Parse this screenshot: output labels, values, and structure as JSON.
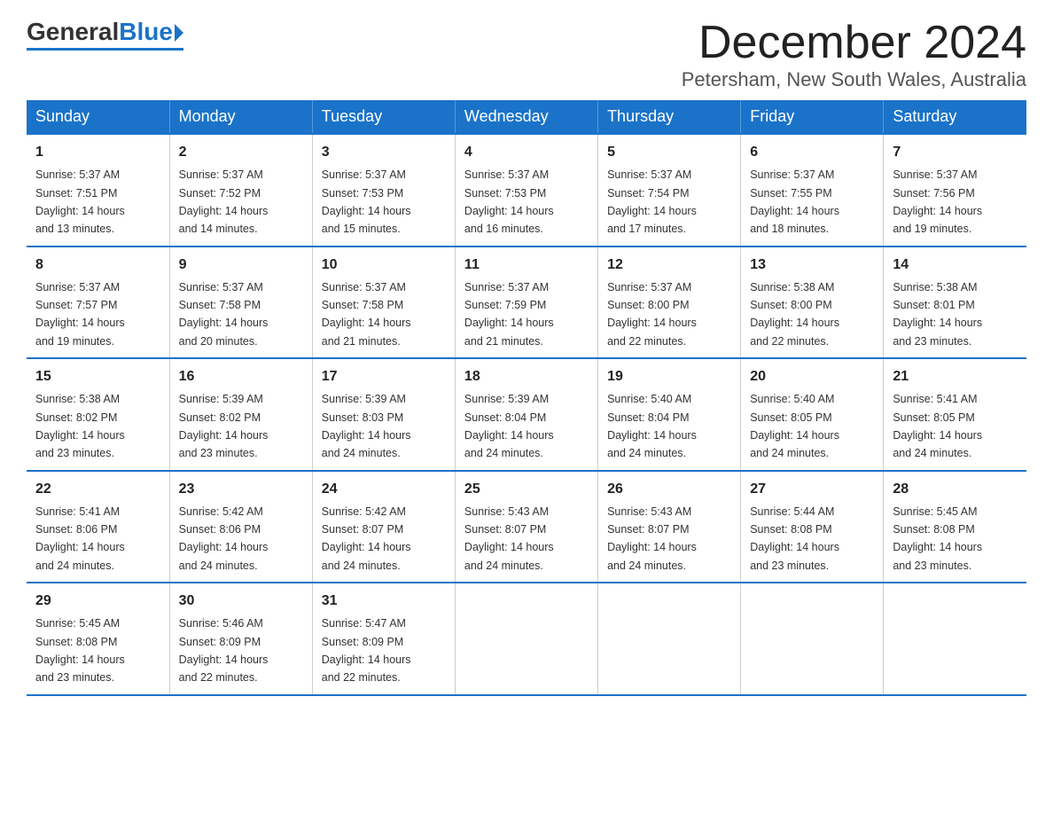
{
  "logo": {
    "general": "General",
    "blue": "Blue"
  },
  "title": "December 2024",
  "location": "Petersham, New South Wales, Australia",
  "weekdays": [
    "Sunday",
    "Monday",
    "Tuesday",
    "Wednesday",
    "Thursday",
    "Friday",
    "Saturday"
  ],
  "weeks": [
    [
      {
        "day": "1",
        "sunrise": "5:37 AM",
        "sunset": "7:51 PM",
        "daylight": "14 hours and 13 minutes."
      },
      {
        "day": "2",
        "sunrise": "5:37 AM",
        "sunset": "7:52 PM",
        "daylight": "14 hours and 14 minutes."
      },
      {
        "day": "3",
        "sunrise": "5:37 AM",
        "sunset": "7:53 PM",
        "daylight": "14 hours and 15 minutes."
      },
      {
        "day": "4",
        "sunrise": "5:37 AM",
        "sunset": "7:53 PM",
        "daylight": "14 hours and 16 minutes."
      },
      {
        "day": "5",
        "sunrise": "5:37 AM",
        "sunset": "7:54 PM",
        "daylight": "14 hours and 17 minutes."
      },
      {
        "day": "6",
        "sunrise": "5:37 AM",
        "sunset": "7:55 PM",
        "daylight": "14 hours and 18 minutes."
      },
      {
        "day": "7",
        "sunrise": "5:37 AM",
        "sunset": "7:56 PM",
        "daylight": "14 hours and 19 minutes."
      }
    ],
    [
      {
        "day": "8",
        "sunrise": "5:37 AM",
        "sunset": "7:57 PM",
        "daylight": "14 hours and 19 minutes."
      },
      {
        "day": "9",
        "sunrise": "5:37 AM",
        "sunset": "7:58 PM",
        "daylight": "14 hours and 20 minutes."
      },
      {
        "day": "10",
        "sunrise": "5:37 AM",
        "sunset": "7:58 PM",
        "daylight": "14 hours and 21 minutes."
      },
      {
        "day": "11",
        "sunrise": "5:37 AM",
        "sunset": "7:59 PM",
        "daylight": "14 hours and 21 minutes."
      },
      {
        "day": "12",
        "sunrise": "5:37 AM",
        "sunset": "8:00 PM",
        "daylight": "14 hours and 22 minutes."
      },
      {
        "day": "13",
        "sunrise": "5:38 AM",
        "sunset": "8:00 PM",
        "daylight": "14 hours and 22 minutes."
      },
      {
        "day": "14",
        "sunrise": "5:38 AM",
        "sunset": "8:01 PM",
        "daylight": "14 hours and 23 minutes."
      }
    ],
    [
      {
        "day": "15",
        "sunrise": "5:38 AM",
        "sunset": "8:02 PM",
        "daylight": "14 hours and 23 minutes."
      },
      {
        "day": "16",
        "sunrise": "5:39 AM",
        "sunset": "8:02 PM",
        "daylight": "14 hours and 23 minutes."
      },
      {
        "day": "17",
        "sunrise": "5:39 AM",
        "sunset": "8:03 PM",
        "daylight": "14 hours and 24 minutes."
      },
      {
        "day": "18",
        "sunrise": "5:39 AM",
        "sunset": "8:04 PM",
        "daylight": "14 hours and 24 minutes."
      },
      {
        "day": "19",
        "sunrise": "5:40 AM",
        "sunset": "8:04 PM",
        "daylight": "14 hours and 24 minutes."
      },
      {
        "day": "20",
        "sunrise": "5:40 AM",
        "sunset": "8:05 PM",
        "daylight": "14 hours and 24 minutes."
      },
      {
        "day": "21",
        "sunrise": "5:41 AM",
        "sunset": "8:05 PM",
        "daylight": "14 hours and 24 minutes."
      }
    ],
    [
      {
        "day": "22",
        "sunrise": "5:41 AM",
        "sunset": "8:06 PM",
        "daylight": "14 hours and 24 minutes."
      },
      {
        "day": "23",
        "sunrise": "5:42 AM",
        "sunset": "8:06 PM",
        "daylight": "14 hours and 24 minutes."
      },
      {
        "day": "24",
        "sunrise": "5:42 AM",
        "sunset": "8:07 PM",
        "daylight": "14 hours and 24 minutes."
      },
      {
        "day": "25",
        "sunrise": "5:43 AM",
        "sunset": "8:07 PM",
        "daylight": "14 hours and 24 minutes."
      },
      {
        "day": "26",
        "sunrise": "5:43 AM",
        "sunset": "8:07 PM",
        "daylight": "14 hours and 24 minutes."
      },
      {
        "day": "27",
        "sunrise": "5:44 AM",
        "sunset": "8:08 PM",
        "daylight": "14 hours and 23 minutes."
      },
      {
        "day": "28",
        "sunrise": "5:45 AM",
        "sunset": "8:08 PM",
        "daylight": "14 hours and 23 minutes."
      }
    ],
    [
      {
        "day": "29",
        "sunrise": "5:45 AM",
        "sunset": "8:08 PM",
        "daylight": "14 hours and 23 minutes."
      },
      {
        "day": "30",
        "sunrise": "5:46 AM",
        "sunset": "8:09 PM",
        "daylight": "14 hours and 22 minutes."
      },
      {
        "day": "31",
        "sunrise": "5:47 AM",
        "sunset": "8:09 PM",
        "daylight": "14 hours and 22 minutes."
      },
      null,
      null,
      null,
      null
    ]
  ],
  "labels": {
    "sunrise": "Sunrise:",
    "sunset": "Sunset:",
    "daylight": "Daylight:"
  }
}
